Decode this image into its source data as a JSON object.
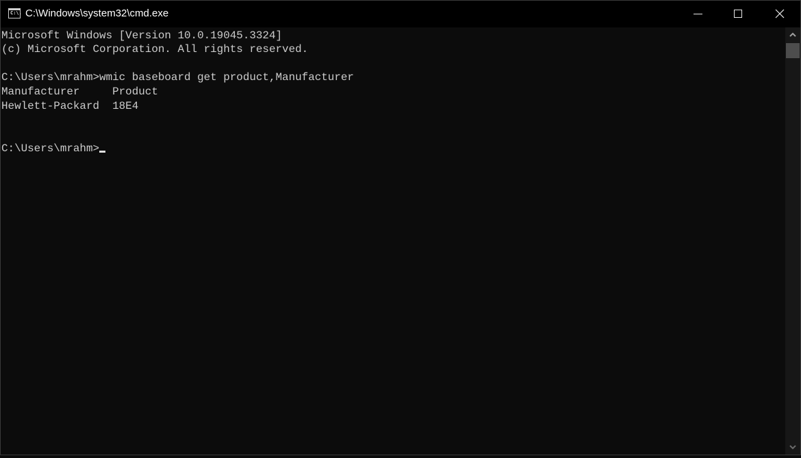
{
  "window": {
    "title": "C:\\Windows\\system32\\cmd.exe",
    "icon": "cmd-icon",
    "icon_text": "C:\\.",
    "controls": {
      "minimize": "minimize-icon",
      "maximize": "maximize-icon",
      "close": "close-icon"
    }
  },
  "console": {
    "lines": [
      "Microsoft Windows [Version 10.0.19045.3324]",
      "(c) Microsoft Corporation. All rights reserved.",
      "",
      "C:\\Users\\mrahm>wmic baseboard get product,Manufacturer",
      "Manufacturer     Product",
      "Hewlett-Packard  18E4",
      "",
      "",
      "C:\\Users\\mrahm>"
    ],
    "prompt": "C:\\Users\\mrahm>",
    "command": "wmic baseboard get product,Manufacturer",
    "output_table": {
      "headers": [
        "Manufacturer",
        "Product"
      ],
      "rows": [
        [
          "Hewlett-Packard",
          "18E4"
        ]
      ]
    },
    "colors": {
      "background": "#0c0c0c",
      "text": "#cccccc"
    }
  },
  "scrollbar": {
    "up": "chevron-up-icon",
    "down": "chevron-down-icon",
    "position": 0
  }
}
